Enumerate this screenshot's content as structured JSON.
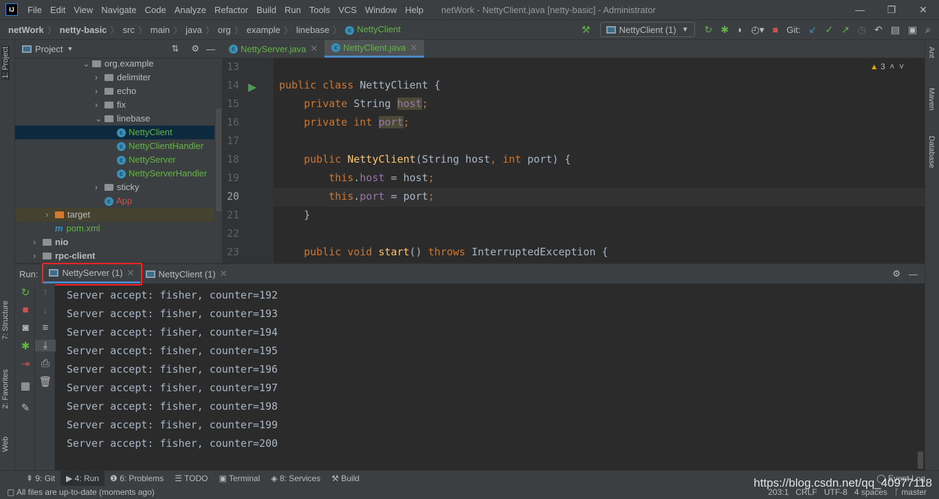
{
  "titlebar": {
    "menu": [
      "File",
      "Edit",
      "View",
      "Navigate",
      "Code",
      "Analyze",
      "Refactor",
      "Build",
      "Run",
      "Tools",
      "VCS",
      "Window",
      "Help"
    ],
    "title": "netWork - NettyClient.java [netty-basic] - Administrator"
  },
  "breadcrumb": [
    "netWork",
    "netty-basic",
    "src",
    "main",
    "java",
    "org",
    "example",
    "linebase",
    "NettyClient"
  ],
  "toolbar": {
    "run_config": "NettyClient (1)",
    "git_label": "Git:"
  },
  "left_strip": {
    "project": "1: Project",
    "structure": "7: Structure",
    "favorites": "2: Favorites",
    "web": "Web"
  },
  "right_strip": {
    "ant": "Ant",
    "maven": "Maven",
    "database": "Database"
  },
  "project": {
    "title": "Project",
    "tree": [
      {
        "label": "org.example",
        "type": "folder",
        "expanded": true
      },
      {
        "label": "delimiter",
        "type": "folder"
      },
      {
        "label": "echo",
        "type": "folder"
      },
      {
        "label": "fix",
        "type": "folder"
      },
      {
        "label": "linebase",
        "type": "folder",
        "expanded": true
      },
      {
        "label": "NettyClient",
        "type": "class",
        "selected": true
      },
      {
        "label": "NettyClientHandler",
        "type": "class"
      },
      {
        "label": "NettyServer",
        "type": "class"
      },
      {
        "label": "NettyServerHandler",
        "type": "class"
      },
      {
        "label": "sticky",
        "type": "folder"
      },
      {
        "label": "App",
        "type": "class-red"
      },
      {
        "label": "target",
        "type": "folder-orange"
      },
      {
        "label": "pom.xml",
        "type": "maven"
      },
      {
        "label": "nio",
        "type": "module"
      },
      {
        "label": "rpc-client",
        "type": "module"
      }
    ]
  },
  "editor": {
    "tabs": [
      "NettyServer.java",
      "NettyClient.java"
    ],
    "active_tab": 1,
    "warnings": "3",
    "lines": [
      {
        "n": "13",
        "html": ""
      },
      {
        "n": "14",
        "html": "<span class=kw>public class </span>NettyClient {"
      },
      {
        "n": "15",
        "html": "    <span class=kw>private </span>String <span class='fd hl'>host</span><span class=kw>;</span>"
      },
      {
        "n": "16",
        "html": "    <span class=kw>private int </span><span class='fd hl'>port</span><span class=kw>;</span>"
      },
      {
        "n": "17",
        "html": ""
      },
      {
        "n": "18",
        "html": "    <span class=kw>public </span><span class=mt>NettyClient</span>(String host<span class=kw>, int </span>port) {"
      },
      {
        "n": "19",
        "html": "        <span class=kw>this</span>.<span class=fd>host</span> = host<span class=kw>;</span>"
      },
      {
        "n": "20",
        "html": "        <span class=kw>this</span>.<span class=fd>port</span> = port<span class=kw>;</span>"
      },
      {
        "n": "21",
        "html": "    }"
      },
      {
        "n": "22",
        "html": ""
      },
      {
        "n": "23",
        "html": "    <span class=kw>public void </span><span class=mt>start</span>() <span class=kw>throws </span>InterruptedException {"
      }
    ],
    "current_line": "20"
  },
  "run": {
    "label": "Run:",
    "tabs": [
      "NettyServer (1)",
      "NettyClient (1)"
    ],
    "active_tab": 0,
    "output": [
      "Server accept: fisher, counter=192",
      "Server accept: fisher, counter=193",
      "Server accept: fisher, counter=194",
      "Server accept: fisher, counter=195",
      "Server accept: fisher, counter=196",
      "Server accept: fisher, counter=197",
      "Server accept: fisher, counter=198",
      "Server accept: fisher, counter=199",
      "Server accept: fisher, counter=200"
    ]
  },
  "bottom_tabs": [
    "9: Git",
    "4: Run",
    "6: Problems",
    "TODO",
    "Terminal",
    "8: Services",
    "Build"
  ],
  "event_log": "Event Log",
  "status": {
    "message": "All files are up-to-date (moments ago)",
    "position": "203:1",
    "line_sep": "CRLF",
    "encoding": "UTF-8",
    "indent": "4 spaces",
    "branch": "master"
  },
  "watermark": "https://blog.csdn.net/qq_40977118",
  "colors": {
    "keyword": "#cc7832",
    "field": "#9876aa",
    "method": "#ffc66d",
    "text": "#a9b7c6",
    "accent": "#4a88c7",
    "highlight": "#ff2222"
  }
}
